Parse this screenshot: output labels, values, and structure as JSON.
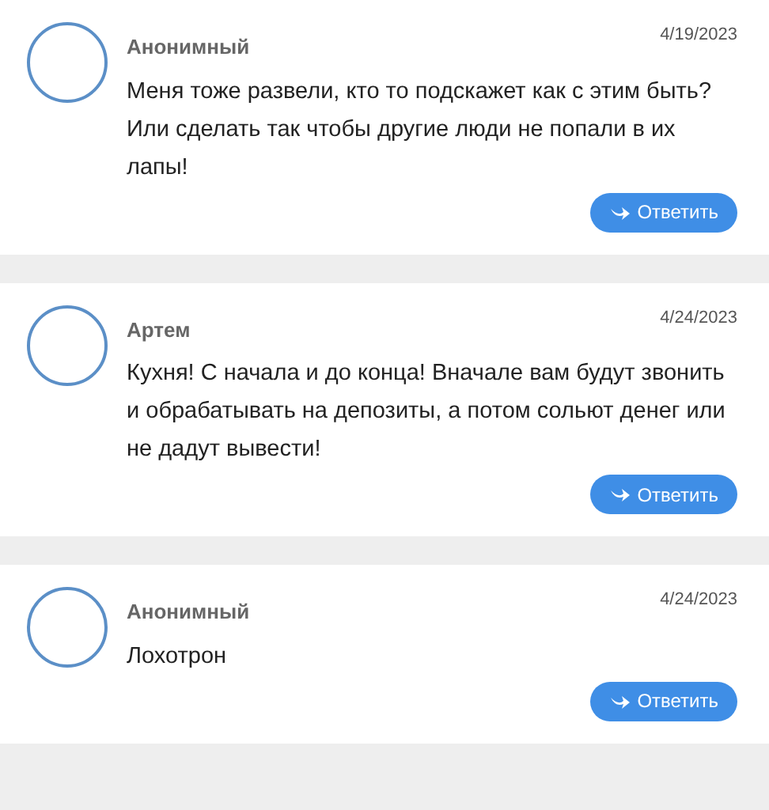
{
  "comments": [
    {
      "author": "Анонимный",
      "date": "4/19/2023",
      "text": "Меня тоже развели, кто то подскажет как с этим быть? Или сделать так чтобы другие люди не попали в их лапы!",
      "reply": "Ответить"
    },
    {
      "author": "Артем",
      "date": "4/24/2023",
      "text": "Кухня! С начала и до конца! Вначале вам будут звонить и обрабатывать на депозиты, а потом сольют денег или не дадут вывести!",
      "reply": "Ответить"
    },
    {
      "author": "Анонимный",
      "date": "4/24/2023",
      "text": "Лохотрон",
      "reply": "Ответить"
    }
  ]
}
